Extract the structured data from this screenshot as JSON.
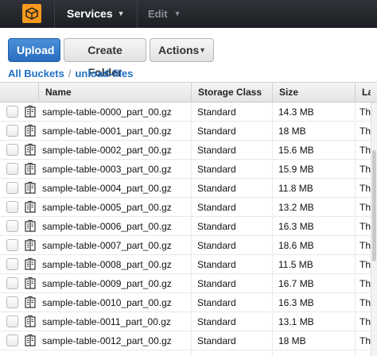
{
  "topbar": {
    "logo_icon": "aws-cube-icon",
    "services_label": "Services",
    "edit_label": "Edit"
  },
  "toolbar": {
    "upload_label": "Upload",
    "create_folder_label": "Create Folder",
    "actions_label": "Actions"
  },
  "breadcrumb": {
    "root": "All Buckets",
    "separator": "/",
    "current": "unload-files"
  },
  "table": {
    "columns": [
      "Name",
      "Storage Class",
      "Size",
      "La"
    ],
    "rows": [
      {
        "name": "sample-table-0000_part_00.gz",
        "storage_class": "Standard",
        "size": "14.3 MB",
        "last_modified": "Thu"
      },
      {
        "name": "sample-table-0001_part_00.gz",
        "storage_class": "Standard",
        "size": "18 MB",
        "last_modified": "Thu"
      },
      {
        "name": "sample-table-0002_part_00.gz",
        "storage_class": "Standard",
        "size": "15.6 MB",
        "last_modified": "Thu"
      },
      {
        "name": "sample-table-0003_part_00.gz",
        "storage_class": "Standard",
        "size": "15.9 MB",
        "last_modified": "Thu"
      },
      {
        "name": "sample-table-0004_part_00.gz",
        "storage_class": "Standard",
        "size": "11.8 MB",
        "last_modified": "Thu"
      },
      {
        "name": "sample-table-0005_part_00.gz",
        "storage_class": "Standard",
        "size": "13.2 MB",
        "last_modified": "Thu"
      },
      {
        "name": "sample-table-0006_part_00.gz",
        "storage_class": "Standard",
        "size": "16.3 MB",
        "last_modified": "Thu"
      },
      {
        "name": "sample-table-0007_part_00.gz",
        "storage_class": "Standard",
        "size": "18.6 MB",
        "last_modified": "Thu"
      },
      {
        "name": "sample-table-0008_part_00.gz",
        "storage_class": "Standard",
        "size": "11.5 MB",
        "last_modified": "Thu"
      },
      {
        "name": "sample-table-0009_part_00.gz",
        "storage_class": "Standard",
        "size": "16.7 MB",
        "last_modified": "Thu"
      },
      {
        "name": "sample-table-0010_part_00.gz",
        "storage_class": "Standard",
        "size": "16.3 MB",
        "last_modified": "Thu"
      },
      {
        "name": "sample-table-0011_part_00.gz",
        "storage_class": "Standard",
        "size": "13.1 MB",
        "last_modified": "Thu"
      },
      {
        "name": "sample-table-0012_part_00.gz",
        "storage_class": "Standard",
        "size": "18 MB",
        "last_modified": "Thu"
      }
    ]
  },
  "colors": {
    "topbar_bg": "#232f3e",
    "logo": "#f79a1e",
    "primary_button": "#2a6dbf",
    "link": "#1f6fc5"
  }
}
